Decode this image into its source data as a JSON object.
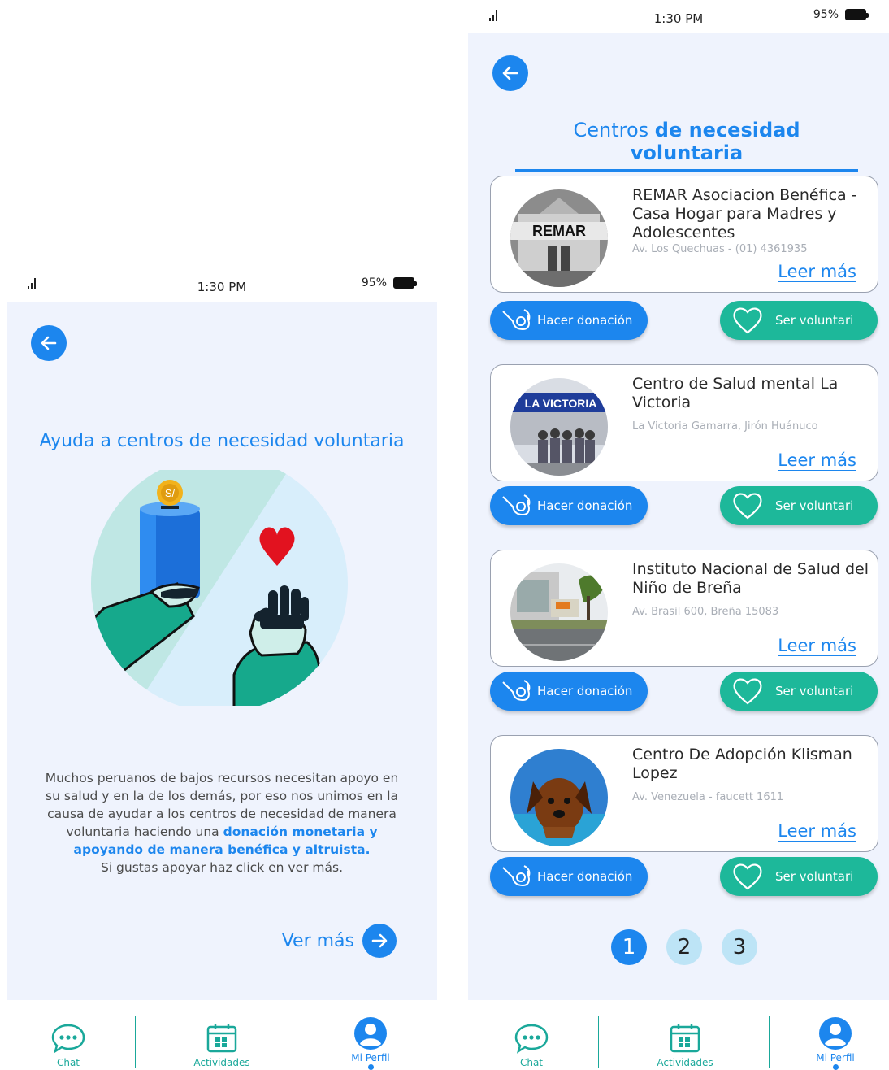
{
  "status": {
    "time": "1:30 PM",
    "battery": "95%"
  },
  "left": {
    "title": "Ayuda a centros de necesidad voluntaria",
    "desc_plain": "Muchos peruanos de bajos recursos necesitan apoyo en su salud y en la de los demás, por eso nos unimos en la causa de ayudar a los centros de necesidad de manera voluntaria haciendo una",
    "desc_bold": "donación monetaria y apoyando de manera benéfica y altruista.",
    "desc_end": "Si gustas apoyar haz click en ver más.",
    "coin_label": "S/",
    "cta": "Ver más"
  },
  "right": {
    "title_plain": "Centros",
    "title_bold": "de necesidad voluntaria",
    "read_more": "Leer más",
    "donate_label": "Hacer donación",
    "volunteer_label": "Ser voluntari",
    "photo_text": {
      "remar": "REMAR",
      "victoria": "LA VICTORIA"
    },
    "cards": [
      {
        "name": "REMAR Asociacion Benéfica - Casa Hogar para Madres y Adolescentes",
        "address": "Av. Los Quechuas - (01) 4361935"
      },
      {
        "name": "Centro de Salud mental La Victoria",
        "address": "La Victoria Gamarra, Jirón Huánuco"
      },
      {
        "name": "Instituto Nacional de Salud del Niño de Breña",
        "address": "Av. Brasil 600, Breña 15083"
      },
      {
        "name": "Centro De Adopción Klisman Lopez",
        "address": "Av. Venezuela - faucett 1611"
      }
    ],
    "pages": [
      "1",
      "2",
      "3"
    ],
    "active_page": "1"
  },
  "tabs": {
    "chat": "Chat",
    "activities": "Actividades",
    "profile": "Mi Perfil"
  },
  "colors": {
    "primary": "#1c86ee",
    "teal": "#1db89a",
    "background": "#eff3fd"
  }
}
